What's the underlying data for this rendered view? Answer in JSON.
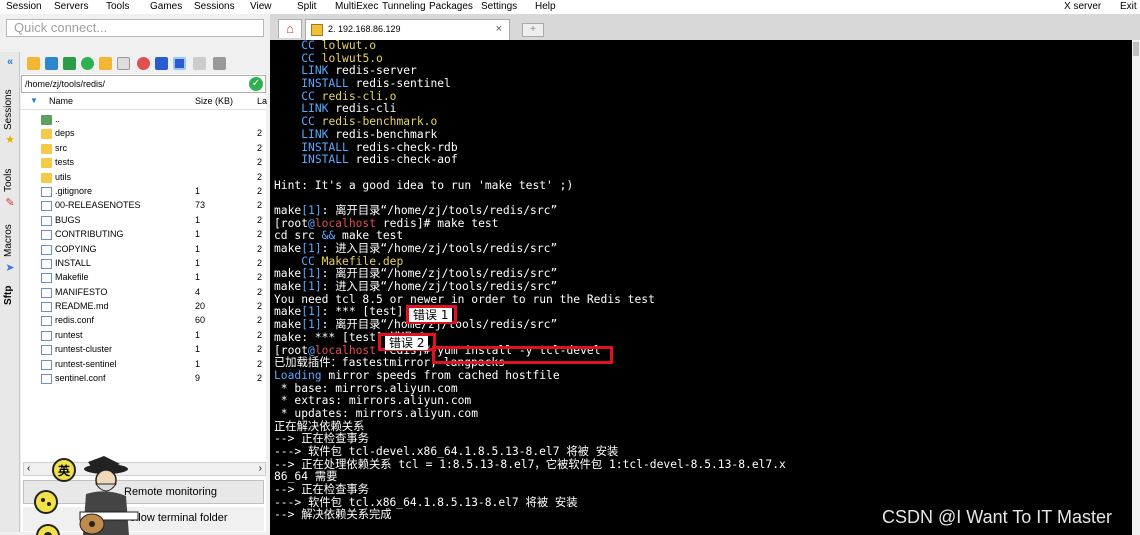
{
  "menu": [
    "Session",
    "Servers",
    "Tools",
    "Games",
    "Sessions",
    "View",
    "Split",
    "MultiExec",
    "Tunneling",
    "Packages",
    "Settings",
    "Help",
    "X server",
    "Exit"
  ],
  "sidebar": {
    "quick_connect_placeholder": "Quick connect...",
    "vertical_tabs": [
      "Sessions",
      "Tools",
      "Macros",
      "Sftp"
    ],
    "path": "/home/zj/tools/redis/",
    "col_name": "Name",
    "col_size": "Size (KB)",
    "col_extra": "La",
    "files": [
      {
        "name": "..",
        "size": "",
        "kind": "up"
      },
      {
        "name": "deps",
        "size": "",
        "kind": "folder"
      },
      {
        "name": "src",
        "size": "",
        "kind": "folder"
      },
      {
        "name": "tests",
        "size": "",
        "kind": "folder"
      },
      {
        "name": "utils",
        "size": "",
        "kind": "folder"
      },
      {
        "name": ".gitignore",
        "size": "1",
        "kind": "file"
      },
      {
        "name": "00-RELEASENOTES",
        "size": "73",
        "kind": "file"
      },
      {
        "name": "BUGS",
        "size": "1",
        "kind": "file"
      },
      {
        "name": "CONTRIBUTING",
        "size": "1",
        "kind": "file"
      },
      {
        "name": "COPYING",
        "size": "1",
        "kind": "file"
      },
      {
        "name": "INSTALL",
        "size": "1",
        "kind": "file"
      },
      {
        "name": "Makefile",
        "size": "1",
        "kind": "file"
      },
      {
        "name": "MANIFESTO",
        "size": "4",
        "kind": "file"
      },
      {
        "name": "README.md",
        "size": "20",
        "kind": "file"
      },
      {
        "name": "redis.conf",
        "size": "60",
        "kind": "conf"
      },
      {
        "name": "runtest",
        "size": "1",
        "kind": "file"
      },
      {
        "name": "runtest-cluster",
        "size": "1",
        "kind": "file"
      },
      {
        "name": "runtest-sentinel",
        "size": "1",
        "kind": "file"
      },
      {
        "name": "sentinel.conf",
        "size": "9",
        "kind": "conf"
      }
    ],
    "col_extra_value": "2",
    "remote_monitoring": "Remote monitoring",
    "follow_terminal": "Follow terminal folder"
  },
  "tabs": {
    "session_title": "2. 192.168.86.129"
  },
  "terminal": {
    "lines": [
      [
        {
          "t": "    "
        },
        {
          "t": "CC",
          "c": "b"
        },
        {
          "t": " "
        },
        {
          "t": "lolwut.o",
          "c": "y"
        }
      ],
      [
        {
          "t": "    "
        },
        {
          "t": "CC",
          "c": "b"
        },
        {
          "t": " "
        },
        {
          "t": "lolwut5.o",
          "c": "y"
        }
      ],
      [
        {
          "t": "    "
        },
        {
          "t": "LINK",
          "c": "b"
        },
        {
          "t": " redis-server"
        }
      ],
      [
        {
          "t": "    "
        },
        {
          "t": "INSTALL",
          "c": "b"
        },
        {
          "t": " redis-sentinel"
        }
      ],
      [
        {
          "t": "    "
        },
        {
          "t": "CC",
          "c": "b"
        },
        {
          "t": " "
        },
        {
          "t": "redis-cli.o",
          "c": "y"
        }
      ],
      [
        {
          "t": "    "
        },
        {
          "t": "LINK",
          "c": "b"
        },
        {
          "t": " redis-cli"
        }
      ],
      [
        {
          "t": "    "
        },
        {
          "t": "CC",
          "c": "b"
        },
        {
          "t": " "
        },
        {
          "t": "redis-benchmark.o",
          "c": "y"
        }
      ],
      [
        {
          "t": "    "
        },
        {
          "t": "LINK",
          "c": "b"
        },
        {
          "t": " redis-benchmark"
        }
      ],
      [
        {
          "t": "    "
        },
        {
          "t": "INSTALL",
          "c": "b"
        },
        {
          "t": " redis-check-rdb"
        }
      ],
      [
        {
          "t": "    "
        },
        {
          "t": "INSTALL",
          "c": "b"
        },
        {
          "t": " redis-check-aof"
        }
      ],
      [
        {
          "t": ""
        }
      ],
      [
        {
          "t": "Hint: It's a good idea to run 'make test' ;)"
        }
      ],
      [
        {
          "t": ""
        }
      ],
      [
        {
          "t": "make"
        },
        {
          "t": "[1]",
          "c": "b"
        },
        {
          "t": ": 离开目录“/home/zj/tools/redis/src”"
        }
      ],
      [
        {
          "t": "[root"
        },
        {
          "t": "@",
          "c": "b"
        },
        {
          "t": "localhost",
          "c": "r"
        },
        {
          "t": " redis]# make test"
        }
      ],
      [
        {
          "t": "cd src "
        },
        {
          "t": "&&",
          "c": "b"
        },
        {
          "t": " make test"
        }
      ],
      [
        {
          "t": "make"
        },
        {
          "t": "[1]",
          "c": "b"
        },
        {
          "t": ": 进入目录“/home/zj/tools/redis/src”"
        }
      ],
      [
        {
          "t": "    "
        },
        {
          "t": "CC",
          "c": "b"
        },
        {
          "t": " "
        },
        {
          "t": "Makefile.dep",
          "c": "y"
        }
      ],
      [
        {
          "t": "make"
        },
        {
          "t": "[1]",
          "c": "b"
        },
        {
          "t": ": 离开目录“/home/zj/tools/redis/src”"
        }
      ],
      [
        {
          "t": "make"
        },
        {
          "t": "[1]",
          "c": "b"
        },
        {
          "t": ": 进入目录“/home/zj/tools/redis/src”"
        }
      ],
      [
        {
          "t": "You need tcl 8.5 or newer in order to run the Redis test"
        }
      ],
      [
        {
          "t": "make"
        },
        {
          "t": "[1]",
          "c": "b"
        },
        {
          "t": ": *** [test] 错误 1"
        }
      ],
      [
        {
          "t": "make"
        },
        {
          "t": "[1]",
          "c": "b"
        },
        {
          "t": ": 离开目录“/home/zj/tools/redis/src”"
        }
      ],
      [
        {
          "t": "make: *** [test] 错误 2"
        }
      ],
      [
        {
          "t": "[root"
        },
        {
          "t": "@",
          "c": "b"
        },
        {
          "t": "localhost",
          "c": "r"
        },
        {
          "t": " redis]# yum install -y tcl-devel"
        }
      ],
      [
        {
          "t": "已加载插件：fastestmirror, langpacks"
        }
      ],
      [
        {
          "t": "Loading",
          "c": "b"
        },
        {
          "t": " mirror speeds from cached hostfile"
        }
      ],
      [
        {
          "t": " * base: mirrors.aliyun.com"
        }
      ],
      [
        {
          "t": " * extras: mirrors.aliyun.com"
        }
      ],
      [
        {
          "t": " * updates: mirrors.aliyun.com"
        }
      ],
      [
        {
          "t": "正在解决依赖关系"
        }
      ],
      [
        {
          "t": "--> 正在检查事务"
        }
      ],
      [
        {
          "t": "---> 软件包 tcl-devel.x86_64.1.8.5.13-8.el7 将被 安装"
        }
      ],
      [
        {
          "t": "--> 正在处理依赖关系 tcl = 1:8.5.13-8.el7，它被软件包 1:tcl-devel-8.5.13-8.el7.x"
        }
      ],
      [
        {
          "t": "86_64 需要"
        }
      ],
      [
        {
          "t": "--> 正在检查事务"
        }
      ],
      [
        {
          "t": "---> 软件包 tcl.x86_64.1.8.5.13-8.el7 将被 安装"
        }
      ],
      [
        {
          "t": "--> 解决依赖关系完成"
        }
      ]
    ]
  },
  "annotations": {
    "error1_label": "错误 1",
    "error2_label": "错误 2",
    "highlight_color": "#e0121f"
  },
  "watermark": "CSDN @I Want To IT Master",
  "colors": {
    "terminal_bg": "#000000",
    "terminal_fg": "#ffffff",
    "blue": "#5aa8ff",
    "yellow": "#e8d45a",
    "red": "#e05050",
    "folder": "#f7c948"
  }
}
